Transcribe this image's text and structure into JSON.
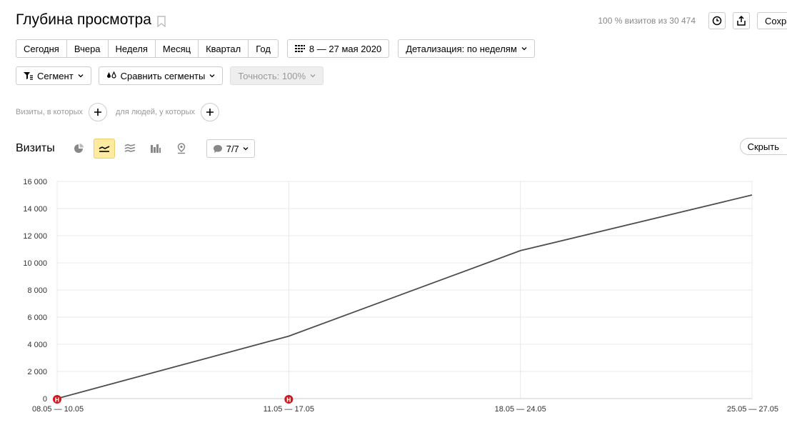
{
  "header": {
    "title": "Глубина просмотра",
    "visits_info": "100 % визитов из 30 474",
    "save_label": "Сохра"
  },
  "period_tabs": [
    "Сегодня",
    "Вчера",
    "Неделя",
    "Месяц",
    "Квартал",
    "Год"
  ],
  "date_range": "8 — 27 мая 2020",
  "detail": "Детализация: по неделям",
  "filters": {
    "segment": "Сегмент",
    "compare": "Сравнить сегменты",
    "accuracy": "Точность: 100%"
  },
  "conditions": {
    "visits_label": "Визиты, в которых",
    "people_label": "для людей, у которых"
  },
  "chart_section": {
    "title": "Визиты",
    "notes_label": "7/7",
    "hide_label": "Скрыть"
  },
  "colors": {
    "line": "#4d4d4d",
    "active_view": "#ffeba0",
    "marker": "#d4151c"
  },
  "chart_data": {
    "type": "line",
    "categories": [
      "08.05 — 10.05",
      "11.05 — 17.05",
      "18.05 — 24.05",
      "25.05 — 27.05"
    ],
    "series": [
      {
        "values": [
          0,
          4600,
          10900,
          15000
        ]
      }
    ],
    "yticks": [
      "0",
      "2 000",
      "4 000",
      "6 000",
      "8 000",
      "10 000",
      "12 000",
      "14 000",
      "16 000"
    ],
    "ylim": [
      0,
      16000
    ],
    "grid": true,
    "markers": [
      {
        "category_index": 0,
        "label": "н"
      },
      {
        "category_index": 1,
        "label": "н"
      }
    ]
  }
}
